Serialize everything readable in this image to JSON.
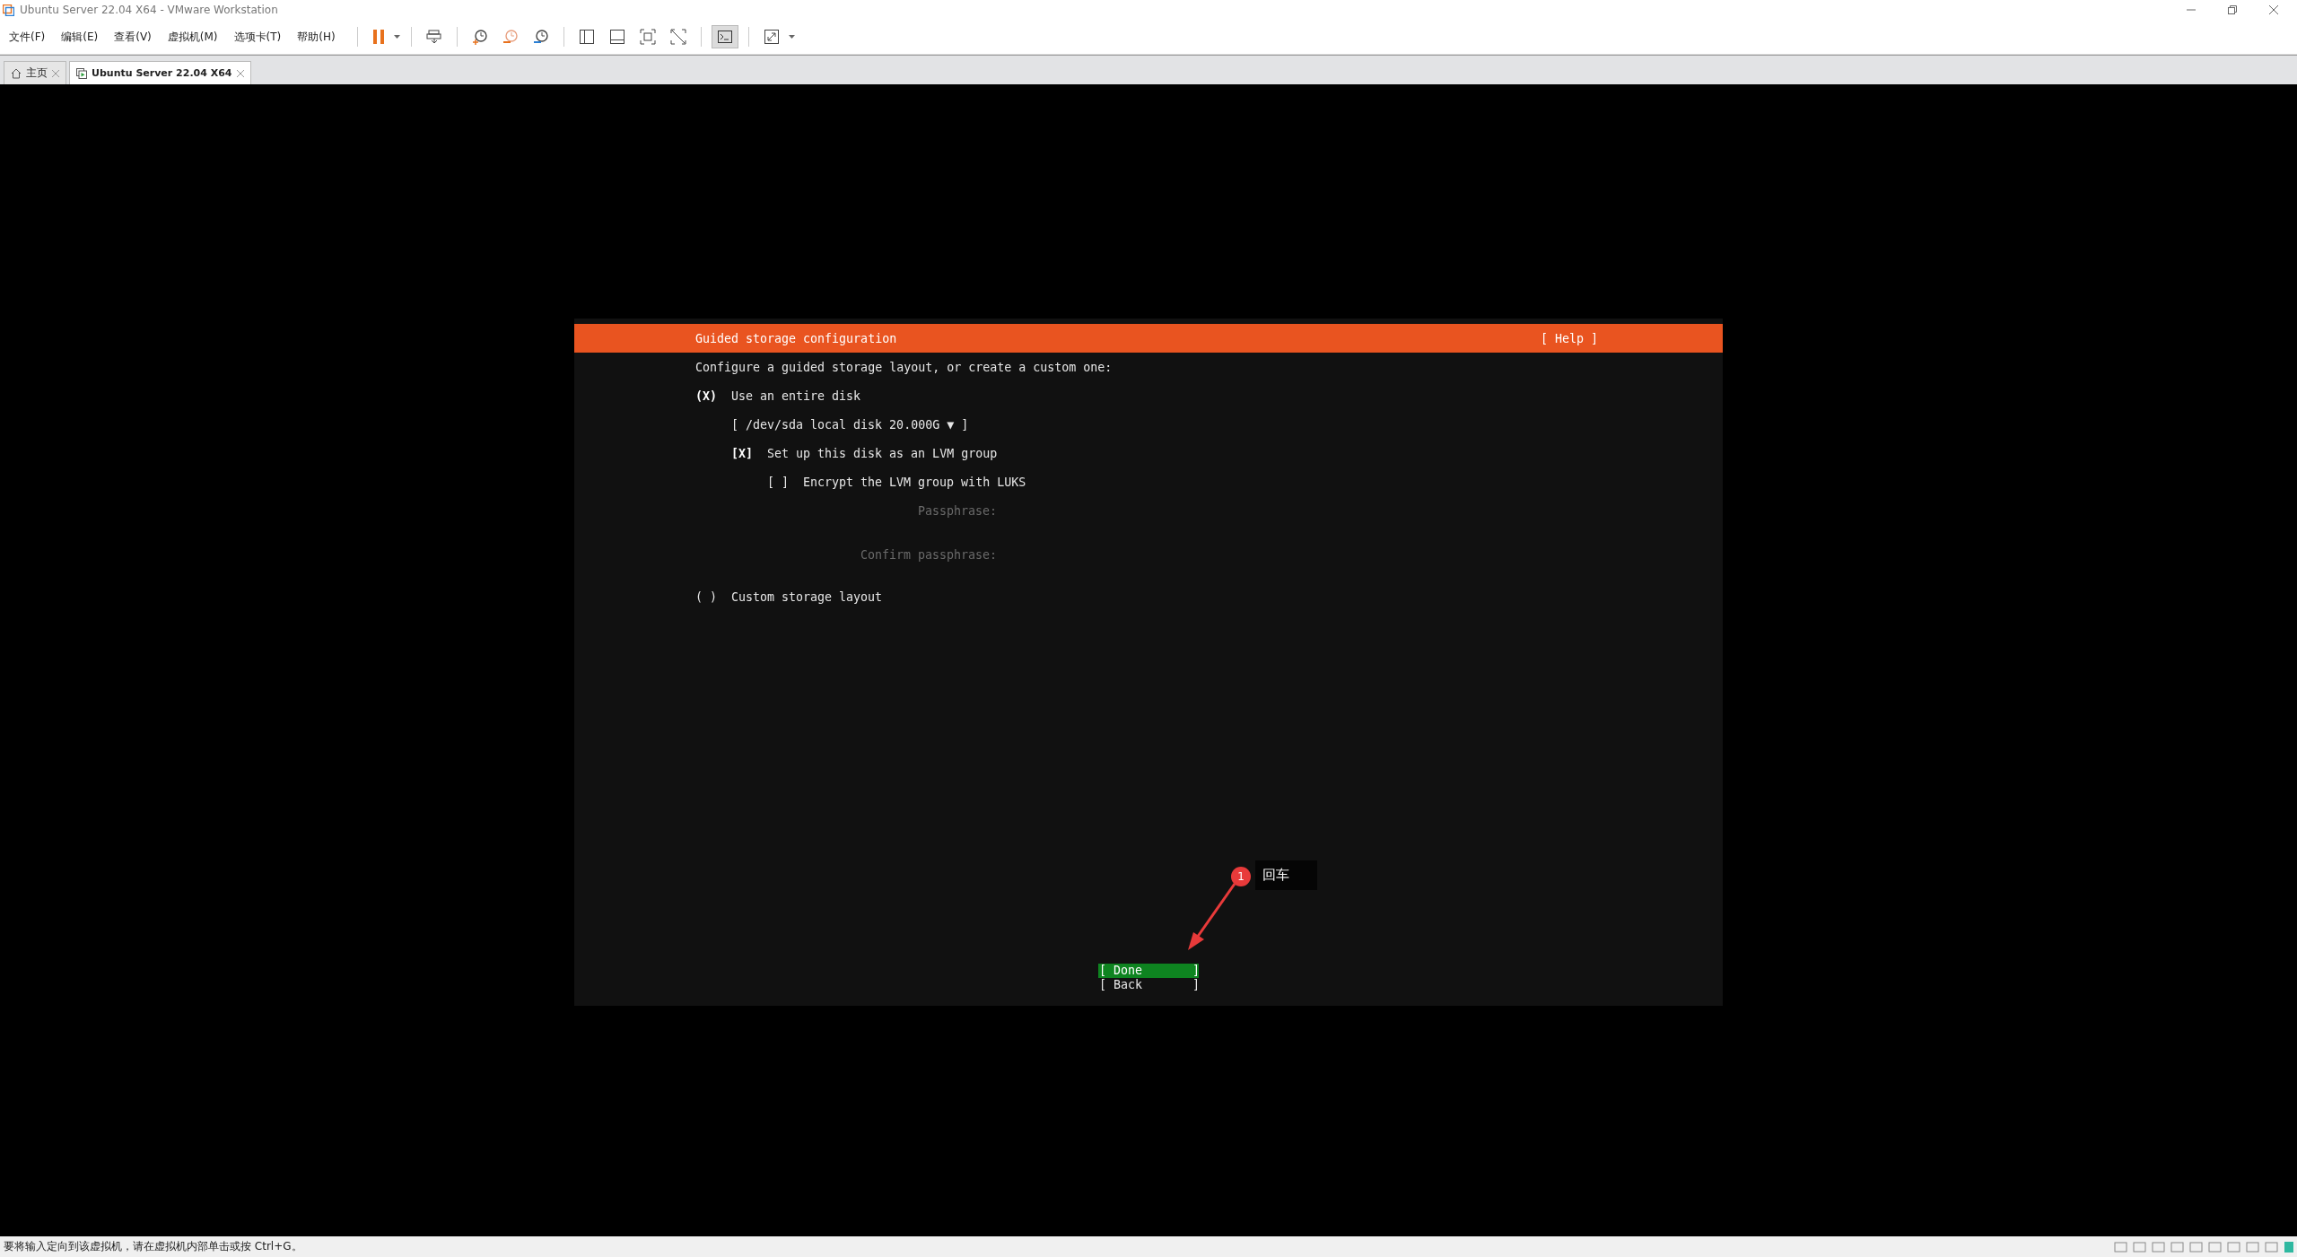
{
  "window": {
    "title": "Ubuntu Server 22.04 X64 - VMware Workstation"
  },
  "menu": [
    "文件(F)",
    "编辑(E)",
    "查看(V)",
    "虚拟机(M)",
    "选项卡(T)",
    "帮助(H)"
  ],
  "toolbar": [
    {
      "kind": "pause",
      "selected": false
    },
    {
      "kind": "send-keys",
      "selected": false
    },
    {
      "kind": "snapshot",
      "selected": false
    },
    {
      "kind": "revert",
      "selected": false
    },
    {
      "kind": "snapshot-manager",
      "selected": false
    },
    {
      "kind": "sidebar",
      "selected": false
    },
    {
      "kind": "thumbnail",
      "selected": false
    },
    {
      "kind": "fullscreen",
      "selected": false
    },
    {
      "kind": "unity",
      "selected": false
    },
    {
      "kind": "console",
      "selected": true
    },
    {
      "kind": "stretch",
      "selected": false
    }
  ],
  "tabs": [
    {
      "kind": "home",
      "label": "主页",
      "selected": false
    },
    {
      "kind": "vm",
      "label": "Ubuntu Server 22.04 X64",
      "selected": true
    }
  ],
  "installer": {
    "title": "Guided storage configuration",
    "help": "[ Help ]",
    "prompt": "Configure a guided storage layout, or create a custom one:",
    "options": [
      {
        "kind": "radio",
        "mark": "(X)",
        "selected": true,
        "label": "Use an entire disk",
        "children": [
          {
            "kind": "dropdown",
            "label": "[ /dev/sda local disk 20.000G ▼ ]"
          },
          {
            "kind": "checkbox",
            "mark": "[X]",
            "checked": true,
            "label": "Set up this disk as an LVM group",
            "children": [
              {
                "kind": "checkbox",
                "mark": "[ ]",
                "checked": false,
                "label": "Encrypt the LVM group with LUKS",
                "children": [
                  {
                    "kind": "field",
                    "label": "Passphrase:",
                    "disabled": true
                  },
                  {
                    "kind": "field",
                    "label": "Confirm passphrase:",
                    "disabled": true
                  }
                ]
              }
            ]
          }
        ]
      },
      {
        "kind": "radio",
        "mark": "( )",
        "selected": false,
        "label": "Custom storage layout"
      }
    ],
    "buttons": [
      {
        "label": "[ Done       ]",
        "selected": true
      },
      {
        "label": "[ Back       ]",
        "selected": false
      }
    ]
  },
  "annotation": {
    "number": "1",
    "text": "回车"
  },
  "status_bar": {
    "text": "要将输入定向到该虚拟机，请在虚拟机内部单击或按 Ctrl+G。"
  }
}
